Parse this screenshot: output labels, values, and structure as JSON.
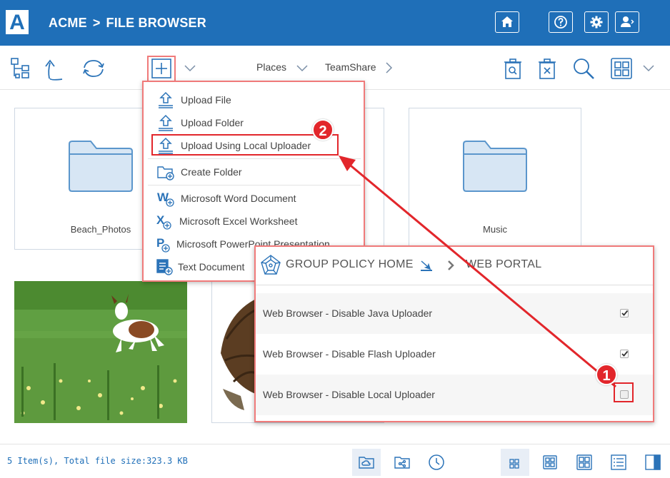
{
  "header": {
    "logo_letter": "A",
    "brand": "ACME",
    "separator": ">",
    "section": "FILE BROWSER",
    "icons": [
      "home-icon",
      "help-icon",
      "gear-icon",
      "user-icon"
    ]
  },
  "toolbar": {
    "places_label": "Places",
    "teamshare_label": "TeamShare",
    "icons": [
      "tree-view-icon",
      "up-folder-icon",
      "refresh-icon",
      "plus-icon",
      "delete-icon",
      "remove-icon",
      "search-icon",
      "grid-view-icon"
    ]
  },
  "add_menu": {
    "items": [
      {
        "label": "Upload File",
        "icon": "upload-icon"
      },
      {
        "label": "Upload Folder",
        "icon": "upload-icon"
      },
      {
        "label": "Upload Using Local Uploader",
        "icon": "upload-icon"
      },
      {
        "label": "Create Folder",
        "icon": "folder-add-icon"
      },
      {
        "label": "Microsoft Word Document",
        "icon": "word-icon"
      },
      {
        "label": "Microsoft Excel Worksheet",
        "icon": "excel-icon"
      },
      {
        "label": "Microsoft PowerPoint Presentation",
        "icon": "powerpoint-icon"
      },
      {
        "label": "Text Document",
        "icon": "text-doc-icon"
      }
    ]
  },
  "files": [
    {
      "name": "Beach_Photos",
      "type": "folder"
    },
    {
      "name": "Music",
      "type": "folder"
    }
  ],
  "group_policy": {
    "title": "GROUP POLICY HOME",
    "sep": ">",
    "subtitle": "WEB PORTAL",
    "rows": [
      {
        "label": "Web Browser - Disable Java Uploader",
        "checked": true
      },
      {
        "label": "Web Browser - Disable Flash Uploader",
        "checked": true
      },
      {
        "label": "Web Browser - Disable Local Uploader",
        "checked": false
      }
    ]
  },
  "badges": [
    "1",
    "2"
  ],
  "status": {
    "text": "5 Item(s), Total file size:323.3 KB"
  },
  "colors": {
    "header_bg": "#1f6fb8",
    "accent_red": "#e2262b",
    "icon_blue": "#2b73b8"
  }
}
